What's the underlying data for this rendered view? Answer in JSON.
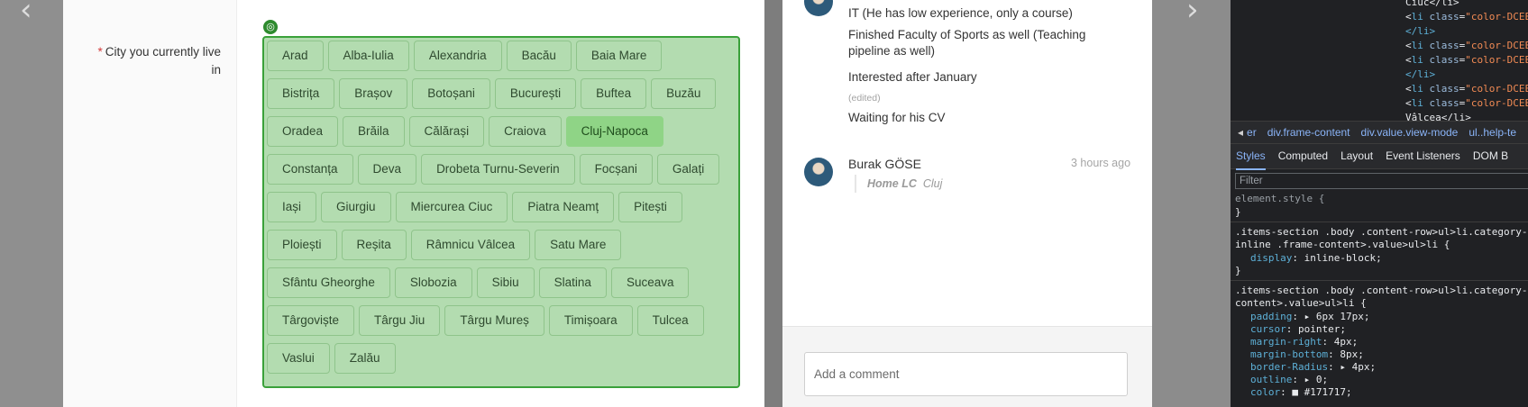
{
  "field": {
    "required_mark": "*",
    "label": "City you currently live in"
  },
  "cities": [
    "Arad",
    "Alba-Iulia",
    "Alexandria",
    "Bacău",
    "Baia Mare",
    "Bistrița",
    "Brașov",
    "Botoșani",
    "București",
    "Buftea",
    "Buzău",
    "Oradea",
    "Brăila",
    "Călărași",
    "Craiova",
    "Cluj-Napoca",
    "Constanța",
    "Deva",
    "Drobeta Turnu-Severin",
    "Focșani",
    "Galați",
    "Iași",
    "Giurgiu",
    "Miercurea Ciuc",
    "Piatra Neamț",
    "Pitești",
    "Ploiești",
    "Reșita",
    "Râmnicu Vâlcea",
    "Satu Mare",
    "Sfântu Gheorghe",
    "Slobozia",
    "Sibiu",
    "Slatina",
    "Suceava",
    "Târgoviște",
    "Târgu Jiu",
    "Târgu Mureș",
    "Timișoara",
    "Tulcea",
    "Vaslui",
    "Zalău"
  ],
  "selected_city": "Cluj-Napoca",
  "comments": {
    "notes": [
      "IT (He has low experience, only a course)",
      "Finished Faculty of Sports as well (Teaching",
      "pipeline as well)",
      "Interested after January",
      "(edited)",
      "Waiting for his CV"
    ],
    "author": "Burak GÖSE",
    "time": "3 hours ago",
    "quote_bold": "Home LC",
    "quote_rest": "Cluj",
    "add_placeholder": "Add a comment"
  },
  "nav": {
    "prev": "‹",
    "next": "›"
  },
  "devtools": {
    "dom_text": "Ciuc</li>",
    "dom_tag": "li",
    "dom_attr": "class",
    "dom_value": "\"color-DCEE",
    "dom_close": "</li>",
    "dom_last": "Vâlcea</li>",
    "crumbs": [
      "er",
      "div.frame-content",
      "div.value.view-mode",
      "ul..help-te"
    ],
    "tabs": [
      "Styles",
      "Computed",
      "Layout",
      "Event Listeners",
      "DOM B"
    ],
    "active_tab": "Styles",
    "filter_placeholder": "Filter",
    "element_style": "element.style {",
    "close_brace": "}",
    "rule1_selector_a": ".items-section .body .content-row>ul>li.category-",
    "rule1_selector_b": "inline .frame-content>.value>ul>li {",
    "rule1_prop": "display",
    "rule1_val": "inline-block;",
    "rule2_selector_a": ".items-section .body .content-row>ul>li.category-",
    "rule2_selector_b": "content>.value>ul>li {",
    "rule2_props": [
      {
        "name": "padding",
        "value": "▸ 6px 17px;"
      },
      {
        "name": "cursor",
        "value": "pointer;"
      },
      {
        "name": "margin-right",
        "value": "4px;"
      },
      {
        "name": "margin-bottom",
        "value": "8px;"
      },
      {
        "name": "border-Radius",
        "value": "▸ 4px;"
      },
      {
        "name": "outline",
        "value": "▸ 0;"
      },
      {
        "name": "color",
        "value": "■ #171717;"
      }
    ]
  }
}
